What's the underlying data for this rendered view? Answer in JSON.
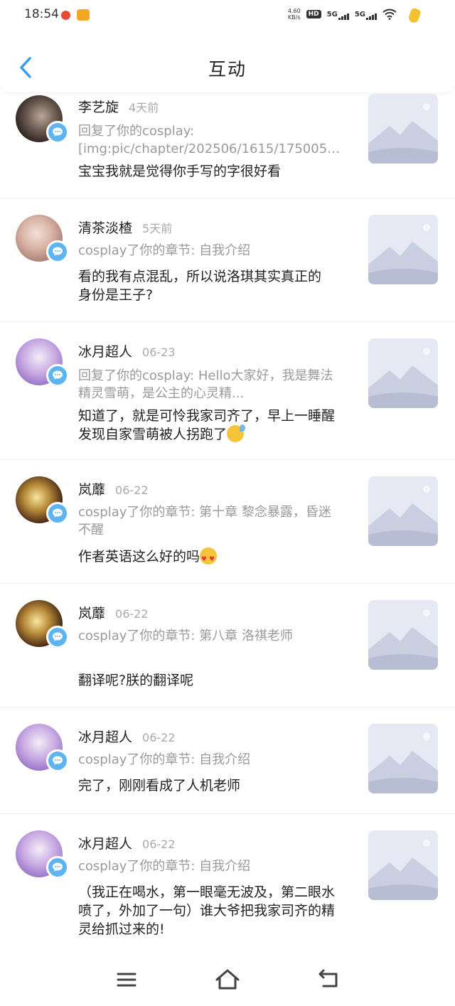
{
  "status_bar": {
    "time": "18:54",
    "net_speed_value": "4.60",
    "net_speed_unit": "KB/s",
    "hd": "HD",
    "sim1": "5G",
    "sim2": "5G"
  },
  "header": {
    "title": "互动"
  },
  "items": [
    {
      "name": "李艺旋",
      "time": "4天前",
      "ref": "回复了你的cosplay: [img:pic/chapter/202506/1615/175005791853...",
      "content": "宝宝我就是觉得你手写的字很好看",
      "emoji": ""
    },
    {
      "name": "清茶淡楂",
      "time": "5天前",
      "ref": "cosplay了你的章节: 自我介绍",
      "content": "看的我有点混乱，所以说洛琪其实真正的身份是王子?",
      "emoji": ""
    },
    {
      "name": "冰月超人",
      "time": "06-23",
      "ref": "回复了你的cosplay: Hello大家好，我是舞法精灵雪萌，是公主的心灵精...",
      "content": "知道了，就是可怜我家司齐了，早上一睡醒发现自家雪萌被人拐跑了",
      "emoji": "sweat"
    },
    {
      "name": "岚蘼",
      "time": "06-22",
      "ref": "cosplay了你的章节: 第十章  黎念暴露，昏迷不醒",
      "content": "作者英语这么好的吗",
      "emoji": "heart-eyes"
    },
    {
      "name": "岚蘼",
      "time": "06-22",
      "ref": "cosplay了你的章节: 第八章  洛祺老师",
      "content": "翻译呢?朕的翻译呢",
      "emoji": ""
    },
    {
      "name": "冰月超人",
      "time": "06-22",
      "ref": "cosplay了你的章节: 自我介绍",
      "content": "完了，刚刚看成了人机老师",
      "emoji": ""
    },
    {
      "name": "冰月超人",
      "time": "06-22",
      "ref": "cosplay了你的章节: 自我介绍",
      "content": "（我正在喝水，第一眼毫无波及，第二眼水喷了，外加了一句）谁大爷把我家司齐的精灵给抓过来的!",
      "emoji": ""
    }
  ],
  "icons": {
    "back": "chevron-left-icon",
    "badge": "comment-bubble-icon",
    "thumb": "image-placeholder-icon",
    "nav": [
      "menu-icon",
      "home-icon",
      "back-icon"
    ]
  },
  "colors": {
    "accent": "#5db4f0",
    "thumb_bg": "#e6e9f4",
    "muted_text": "#9a9a9a"
  }
}
